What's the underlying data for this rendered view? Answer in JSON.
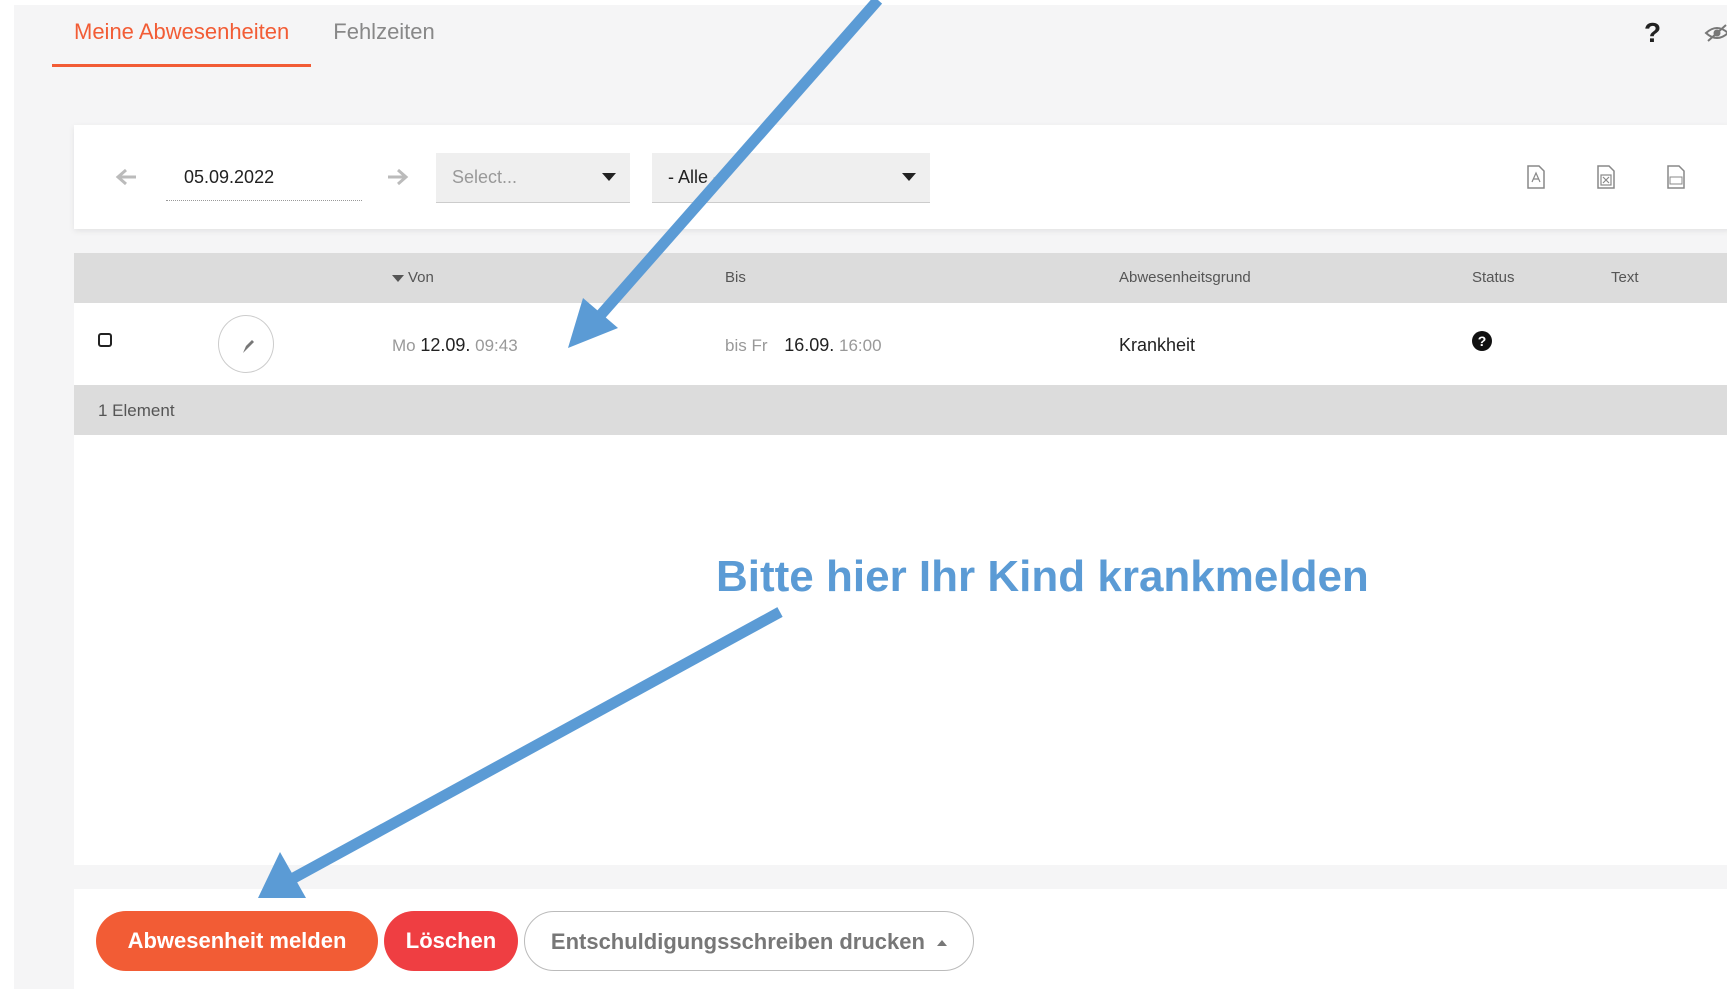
{
  "tabs": [
    {
      "label": "Meine Abwesenheiten",
      "active": true
    },
    {
      "label": "Fehlzeiten",
      "active": false
    }
  ],
  "header": {
    "help_label": "?"
  },
  "toolbar": {
    "date": "05.09.2022",
    "select_placeholder": "Select...",
    "filter_value": "- Alle -"
  },
  "table": {
    "columns": {
      "von": "Von",
      "bis": "Bis",
      "grund": "Abwesenheitsgrund",
      "status": "Status",
      "text": "Text"
    },
    "rows": [
      {
        "von_day": "Mo",
        "von_date": "12.09.",
        "von_time": "09:43",
        "bis_prefix": "bis Fr",
        "bis_date": "16.09.",
        "bis_time": "16:00",
        "grund": "Krankheit",
        "status_icon": "?"
      }
    ],
    "footer": "1 Element"
  },
  "buttons": {
    "report": "Abwesenheit melden",
    "delete": "Löschen",
    "print": "Entschuldigungsschreiben drucken"
  },
  "annotation": {
    "text": "Bitte hier Ihr Kind krankmelden",
    "color": "#5b9bd5"
  },
  "colors": {
    "accent": "#f25c35",
    "danger": "#ef3e42"
  }
}
